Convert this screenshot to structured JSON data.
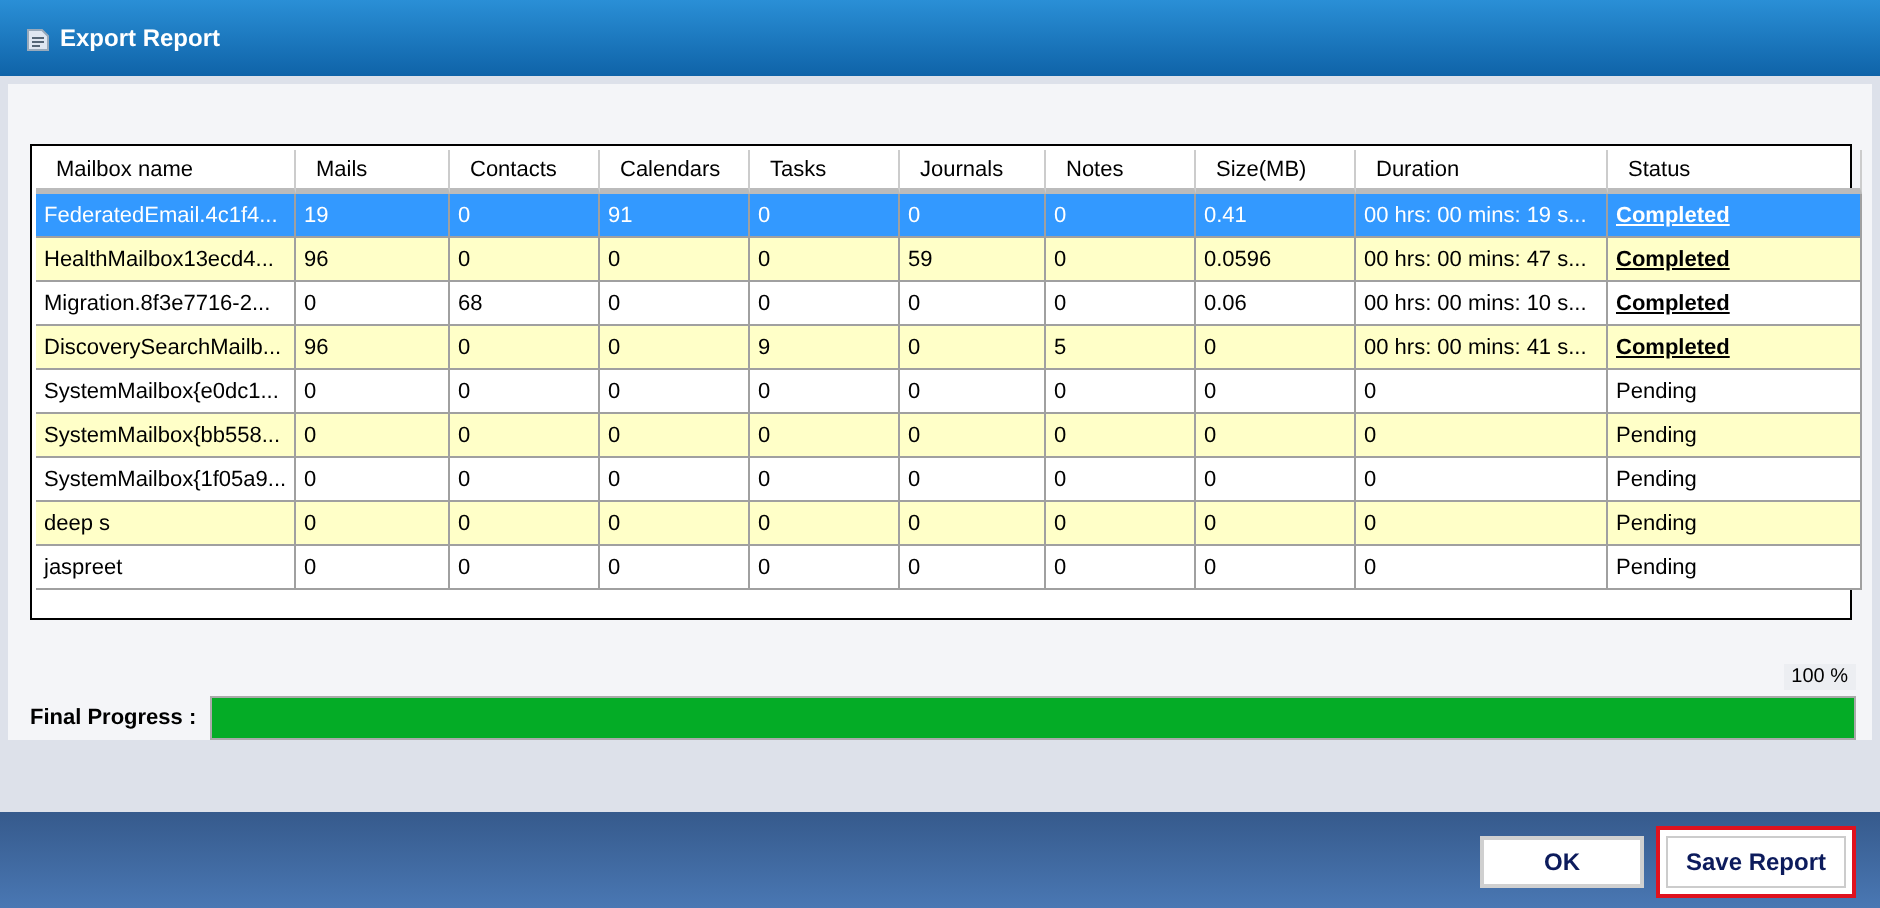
{
  "window": {
    "title": "Export Report"
  },
  "table": {
    "columns": [
      "Mailbox name",
      "Mails",
      "Contacts",
      "Calendars",
      "Tasks",
      "Journals",
      "Notes",
      "Size(MB)",
      "Duration",
      "Status"
    ],
    "rows": [
      {
        "selected": true,
        "cells": [
          "FederatedEmail.4c1f4...",
          "19",
          "0",
          "91",
          "0",
          "0",
          "0",
          "0.41",
          "00 hrs: 00 mins: 19 s..."
        ],
        "status": {
          "text": "Completed",
          "kind": "link"
        }
      },
      {
        "selected": false,
        "cells": [
          "HealthMailbox13ecd4...",
          "96",
          "0",
          "0",
          "0",
          "59",
          "0",
          "0.0596",
          "00 hrs: 00 mins: 47 s..."
        ],
        "status": {
          "text": "Completed",
          "kind": "link"
        }
      },
      {
        "selected": false,
        "cells": [
          "Migration.8f3e7716-2...",
          "0",
          "68",
          "0",
          "0",
          "0",
          "0",
          "0.06",
          "00 hrs: 00 mins: 10 s..."
        ],
        "status": {
          "text": "Completed",
          "kind": "link"
        }
      },
      {
        "selected": false,
        "cells": [
          "DiscoverySearchMailb...",
          "96",
          "0",
          "0",
          "9",
          "0",
          "5",
          "0",
          "00 hrs: 00 mins: 41 s..."
        ],
        "status": {
          "text": "Completed",
          "kind": "link"
        }
      },
      {
        "selected": false,
        "cells": [
          "SystemMailbox{e0dc1...",
          "0",
          "0",
          "0",
          "0",
          "0",
          "0",
          "0",
          "0"
        ],
        "status": {
          "text": "Pending",
          "kind": "plain"
        }
      },
      {
        "selected": false,
        "cells": [
          "SystemMailbox{bb558...",
          "0",
          "0",
          "0",
          "0",
          "0",
          "0",
          "0",
          "0"
        ],
        "status": {
          "text": "Pending",
          "kind": "plain"
        }
      },
      {
        "selected": false,
        "cells": [
          "SystemMailbox{1f05a9...",
          "0",
          "0",
          "0",
          "0",
          "0",
          "0",
          "0",
          "0"
        ],
        "status": {
          "text": "Pending",
          "kind": "plain"
        }
      },
      {
        "selected": false,
        "cells": [
          "deep s",
          "0",
          "0",
          "0",
          "0",
          "0",
          "0",
          "0",
          "0"
        ],
        "status": {
          "text": "Pending",
          "kind": "plain"
        }
      },
      {
        "selected": false,
        "cells": [
          "jaspreet",
          "0",
          "0",
          "0",
          "0",
          "0",
          "0",
          "0",
          "0"
        ],
        "status": {
          "text": "Pending",
          "kind": "plain"
        }
      }
    ]
  },
  "progress": {
    "label": "Final Progress :",
    "reading": "100 %",
    "level": 1
  },
  "buttons": [
    {
      "label": "OK",
      "highlighted": false
    },
    {
      "label": "Save Report",
      "highlighted": true
    }
  ]
}
